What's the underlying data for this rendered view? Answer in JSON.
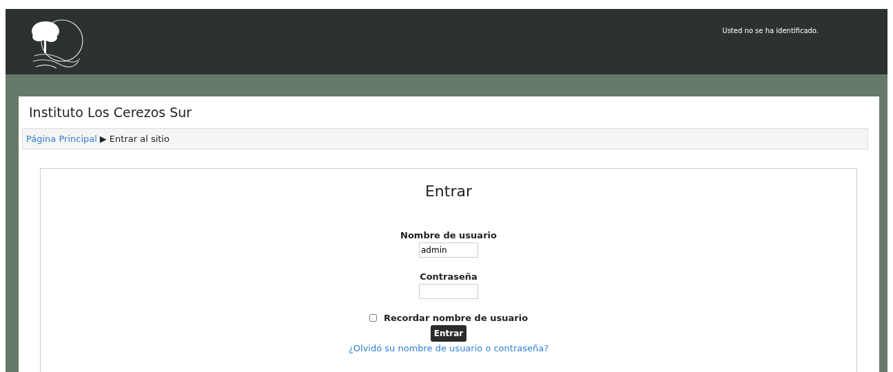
{
  "header": {
    "login_status": "Usted no se ha identificado."
  },
  "site_title": "Instituto Los Cerezos Sur",
  "breadcrumb": [
    {
      "label": "Página Principal",
      "kind": "link"
    },
    {
      "label": "▶",
      "kind": "separator"
    },
    {
      "label": "Entrar al sitio",
      "kind": "current"
    }
  ],
  "login": {
    "title": "Entrar",
    "fields": [
      {
        "label": "Nombre de usuario",
        "value": "admin"
      },
      {
        "label": "Contraseña"
      }
    ],
    "remember": {
      "label": "Recordar nombre de usuario",
      "checked": false
    },
    "submit": "Entrar",
    "forgot_link": "¿Olvidó su nombre de usuario o contraseña?"
  }
}
